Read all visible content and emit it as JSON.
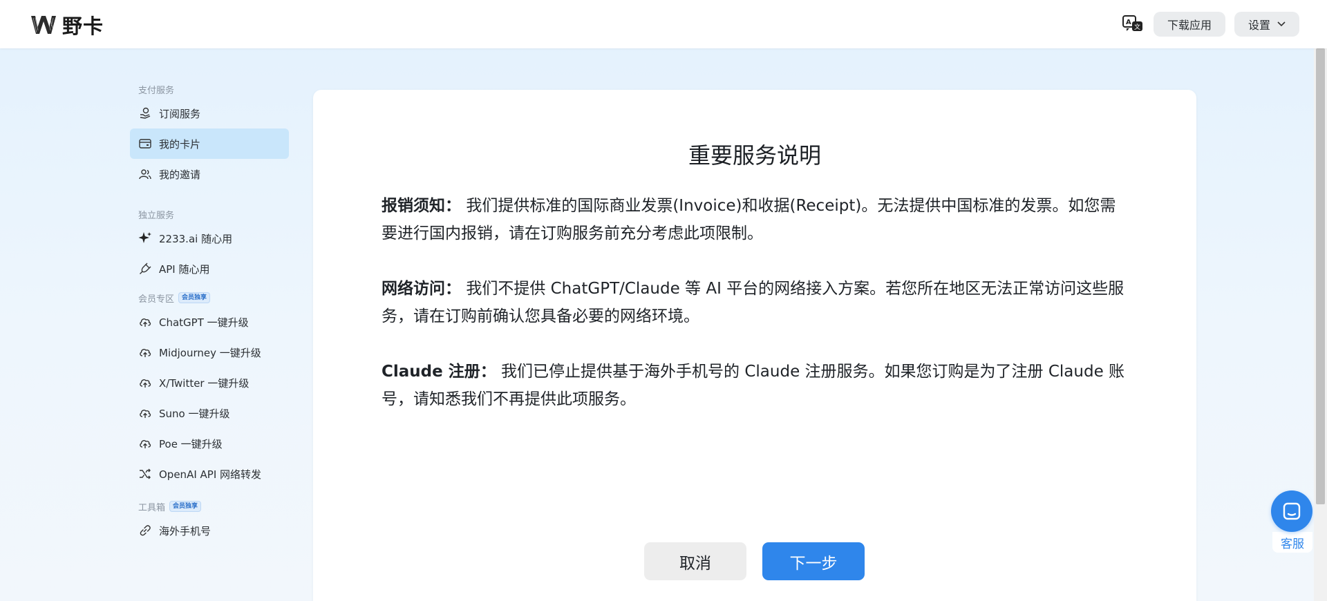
{
  "header": {
    "brand_name": "野卡",
    "lang_icon": "translate-icon",
    "download_label": "下载应用",
    "settings_label": "设置"
  },
  "sidebar": {
    "sections": [
      {
        "label": "支付服务",
        "badge": "",
        "items": [
          {
            "label": "订阅服务",
            "icon": "hand-coin-icon",
            "active": false
          },
          {
            "label": "我的卡片",
            "icon": "card-icon",
            "active": true
          },
          {
            "label": "我的邀请",
            "icon": "users-icon",
            "active": false
          }
        ]
      },
      {
        "label": "独立服务",
        "badge": "",
        "items": [
          {
            "label": "2233.ai 随心用",
            "icon": "sparkle-icon",
            "active": false
          },
          {
            "label": "API 随心用",
            "icon": "plug-icon",
            "active": false
          }
        ]
      },
      {
        "label": "会员专区",
        "badge": "会员独享",
        "items": [
          {
            "label": "ChatGPT 一键升级",
            "icon": "cloud-upload-icon",
            "active": false
          },
          {
            "label": "Midjourney 一键升级",
            "icon": "cloud-upload-icon",
            "active": false
          },
          {
            "label": "X/Twitter 一键升级",
            "icon": "cloud-upload-icon",
            "active": false
          },
          {
            "label": "Suno 一键升级",
            "icon": "cloud-upload-icon",
            "active": false
          },
          {
            "label": "Poe 一键升级",
            "icon": "cloud-upload-icon",
            "active": false
          },
          {
            "label": "OpenAI API 网络转发",
            "icon": "shuffle-icon",
            "active": false
          }
        ]
      },
      {
        "label": "工具箱",
        "badge": "会员独享",
        "items": [
          {
            "label": "海外手机号",
            "icon": "link-icon",
            "active": false
          }
        ]
      }
    ]
  },
  "main": {
    "title": "重要服务说明",
    "notices": [
      {
        "lead": "报销须知：",
        "text": "我们提供标准的国际商业发票(Invoice)和收据(Receipt)。无法提供中国标准的发票。如您需要进行国内报销，请在订购服务前充分考虑此项限制。"
      },
      {
        "lead": "网络访问：",
        "text": "我们不提供 ChatGPT/Claude 等 AI 平台的网络接入方案。若您所在地区无法正常访问这些服务，请在订购前确认您具备必要的网络环境。"
      },
      {
        "lead": "Claude 注册：",
        "text": "我们已停止提供基于海外手机号的 Claude 注册服务。如果您订购是为了注册 Claude 账号，请知悉我们不再提供此项服务。"
      }
    ],
    "cancel_label": "取消",
    "next_label": "下一步"
  },
  "support": {
    "label": "客服",
    "icon": "chat-icon"
  },
  "colors": {
    "primary": "#2f86eb",
    "active_nav": "#c9e6fb",
    "background": "#e3f1fd"
  }
}
